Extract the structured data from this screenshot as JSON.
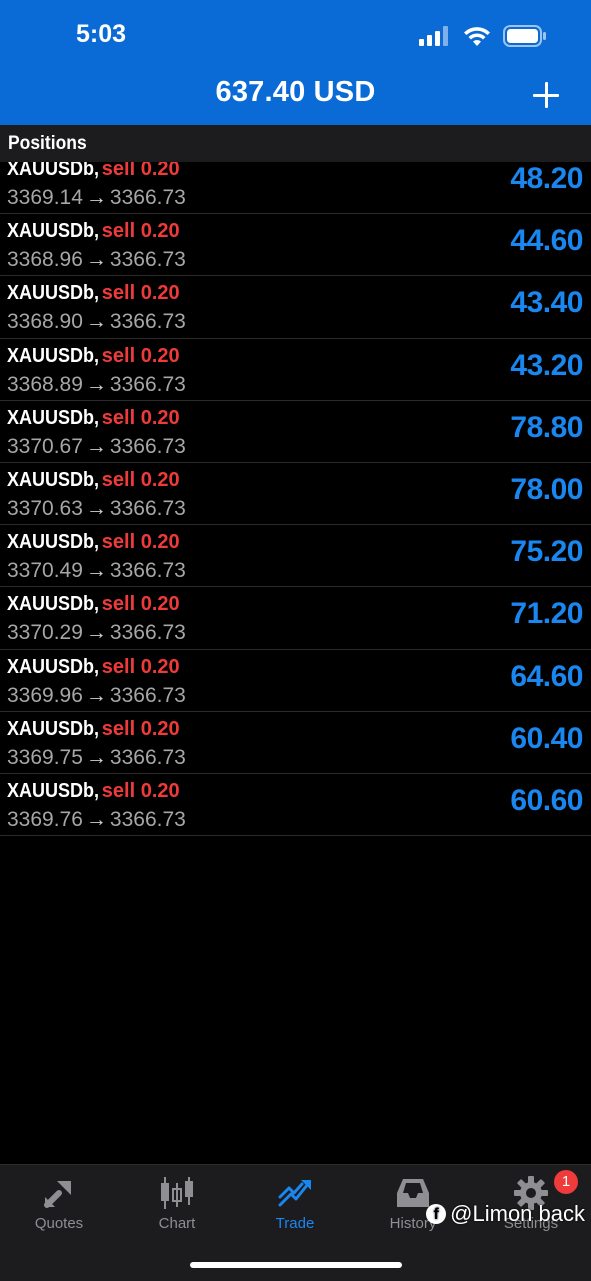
{
  "status_bar": {
    "time": "5:03"
  },
  "header": {
    "balance": "637.40 USD"
  },
  "section": {
    "title": "Positions"
  },
  "positions": [
    {
      "symbol": "XAUUSDb,",
      "direction": "sell 0.20",
      "open": "3369.14",
      "arrow": "→",
      "current": "3366.73",
      "profit": "48.20"
    },
    {
      "symbol": "XAUUSDb,",
      "direction": "sell 0.20",
      "open": "3368.96",
      "arrow": "→",
      "current": "3366.73",
      "profit": "44.60"
    },
    {
      "symbol": "XAUUSDb,",
      "direction": "sell 0.20",
      "open": "3368.90",
      "arrow": "→",
      "current": "3366.73",
      "profit": "43.40"
    },
    {
      "symbol": "XAUUSDb,",
      "direction": "sell 0.20",
      "open": "3368.89",
      "arrow": "→",
      "current": "3366.73",
      "profit": "43.20"
    },
    {
      "symbol": "XAUUSDb,",
      "direction": "sell 0.20",
      "open": "3370.67",
      "arrow": "→",
      "current": "3366.73",
      "profit": "78.80"
    },
    {
      "symbol": "XAUUSDb,",
      "direction": "sell 0.20",
      "open": "3370.63",
      "arrow": "→",
      "current": "3366.73",
      "profit": "78.00"
    },
    {
      "symbol": "XAUUSDb,",
      "direction": "sell 0.20",
      "open": "3370.49",
      "arrow": "→",
      "current": "3366.73",
      "profit": "75.20"
    },
    {
      "symbol": "XAUUSDb,",
      "direction": "sell 0.20",
      "open": "3370.29",
      "arrow": "→",
      "current": "3366.73",
      "profit": "71.20"
    },
    {
      "symbol": "XAUUSDb,",
      "direction": "sell 0.20",
      "open": "3369.96",
      "arrow": "→",
      "current": "3366.73",
      "profit": "64.60"
    },
    {
      "symbol": "XAUUSDb,",
      "direction": "sell 0.20",
      "open": "3369.75",
      "arrow": "→",
      "current": "3366.73",
      "profit": "60.40"
    },
    {
      "symbol": "XAUUSDb,",
      "direction": "sell 0.20",
      "open": "3369.76",
      "arrow": "→",
      "current": "3366.73",
      "profit": "60.60"
    }
  ],
  "tabs": [
    {
      "label": "Quotes",
      "icon": "quotes-icon"
    },
    {
      "label": "Chart",
      "icon": "chart-icon"
    },
    {
      "label": "Trade",
      "icon": "trade-icon",
      "active": true
    },
    {
      "label": "History",
      "icon": "history-icon"
    },
    {
      "label": "Settings",
      "icon": "gear-icon",
      "badge": "1"
    }
  ],
  "watermark": {
    "text": "@Limon back"
  },
  "colors": {
    "header_bg": "#0a6bd6",
    "profit": "#1a86f0",
    "sell": "#ee3a3a",
    "active_tab": "#1a86f0"
  }
}
